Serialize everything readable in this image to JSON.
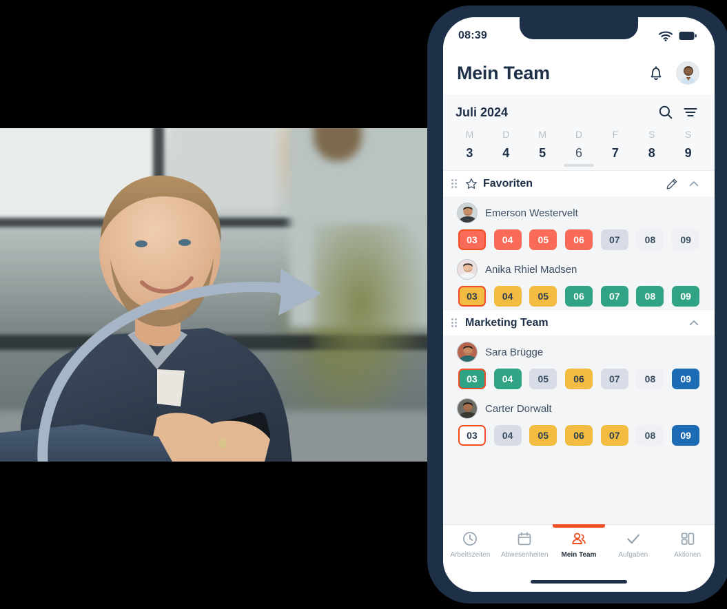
{
  "status_bar": {
    "time": "08:39",
    "wifi_icon": "wifi-icon",
    "battery_icon": "battery-full-icon"
  },
  "header": {
    "title": "Mein Team",
    "notifications_icon": "bell-icon",
    "profile_avatar": "user-avatar"
  },
  "calendar": {
    "month_label": "Juli 2024",
    "search_icon": "search-icon",
    "filter_icon": "filter-icon",
    "weekday_labels": [
      "M",
      "D",
      "M",
      "D",
      "F",
      "S",
      "S"
    ],
    "days": [
      "3",
      "4",
      "5",
      "6",
      "7",
      "8",
      "9"
    ],
    "today_index": 3
  },
  "sections": [
    {
      "title": "Favoriten",
      "drag_handle_icon": "drag-handle-icon",
      "star_icon": "star-icon",
      "edit_icon": "pencil-icon",
      "collapse_icon": "chevron-up-icon",
      "members": [
        {
          "name": "Emerson Westervelt",
          "avatar": "avatar-emerson",
          "chips": [
            {
              "label": "03",
              "style": "c-coral",
              "selected": true
            },
            {
              "label": "04",
              "style": "c-coral",
              "selected": false
            },
            {
              "label": "05",
              "style": "c-coral",
              "selected": false
            },
            {
              "label": "06",
              "style": "c-coral",
              "selected": false
            },
            {
              "label": "07",
              "style": "c-gray",
              "selected": false
            },
            {
              "label": "08",
              "style": "c-lgray",
              "selected": false
            },
            {
              "label": "09",
              "style": "c-lgray",
              "selected": false
            }
          ]
        },
        {
          "name": "Anika Rhiel Madsen",
          "avatar": "avatar-anika",
          "chips": [
            {
              "label": "03",
              "style": "c-yellow",
              "selected": true
            },
            {
              "label": "04",
              "style": "c-yellow",
              "selected": false
            },
            {
              "label": "05",
              "style": "c-yellow",
              "selected": false
            },
            {
              "label": "06",
              "style": "c-green",
              "selected": false
            },
            {
              "label": "07",
              "style": "c-green",
              "selected": false
            },
            {
              "label": "08",
              "style": "c-green",
              "selected": false
            },
            {
              "label": "09",
              "style": "c-green",
              "selected": false
            }
          ]
        }
      ]
    },
    {
      "title": "Marketing Team",
      "drag_handle_icon": "drag-handle-icon",
      "star_icon": null,
      "edit_icon": null,
      "collapse_icon": "chevron-up-icon",
      "members": [
        {
          "name": "Sara Brügge",
          "avatar": "avatar-sara",
          "chips": [
            {
              "label": "03",
              "style": "c-green",
              "selected": true
            },
            {
              "label": "04",
              "style": "c-green",
              "selected": false
            },
            {
              "label": "05",
              "style": "c-gray",
              "selected": false
            },
            {
              "label": "06",
              "style": "c-yellow",
              "selected": false
            },
            {
              "label": "07",
              "style": "c-gray",
              "selected": false
            },
            {
              "label": "08",
              "style": "c-lgray",
              "selected": false
            },
            {
              "label": "09",
              "style": "c-blue",
              "selected": false
            }
          ]
        },
        {
          "name": "Carter Dorwalt",
          "avatar": "avatar-carter",
          "chips": [
            {
              "label": "03",
              "style": "c-white",
              "selected": true
            },
            {
              "label": "04",
              "style": "c-gray",
              "selected": false
            },
            {
              "label": "05",
              "style": "c-yellow",
              "selected": false
            },
            {
              "label": "06",
              "style": "c-yellow",
              "selected": false
            },
            {
              "label": "07",
              "style": "c-yellow",
              "selected": false
            },
            {
              "label": "08",
              "style": "c-lgray",
              "selected": false
            },
            {
              "label": "09",
              "style": "c-blue",
              "selected": false
            }
          ]
        }
      ]
    }
  ],
  "tabbar": {
    "active_index": 2,
    "items": [
      {
        "label": "Arbeitszeiten",
        "icon": "clock-icon"
      },
      {
        "label": "Abwesenheiten",
        "icon": "calendar-icon"
      },
      {
        "label": "Mein Team",
        "icon": "people-icon"
      },
      {
        "label": "Aufgaben",
        "icon": "check-icon"
      },
      {
        "label": "Aktionen",
        "icon": "grid-layout-icon"
      }
    ]
  },
  "colors": {
    "accent": "#f04e23",
    "navy": "#1d3047",
    "coral": "#fa6a58",
    "yellow": "#f2bc42",
    "green": "#2fa383",
    "blue": "#1b6cb5",
    "gray": "#d7dce6",
    "light_gray": "#eef0f3"
  },
  "photo": {
    "alt": "smiling man in dark polo shirt sitting on sofa holding a smartphone",
    "arrow_icon": "curved-arrow-icon"
  }
}
